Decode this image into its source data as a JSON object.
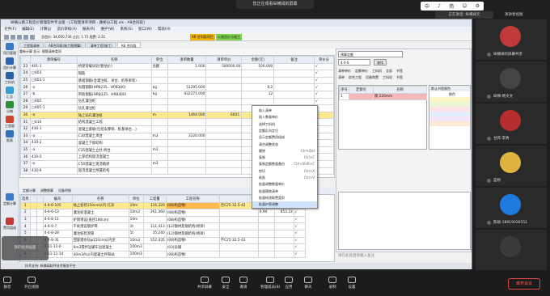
{
  "meeting": {
    "banner": "您正在观看纵横阔的屏幕",
    "speaking": "正在讲话: 纵横阔元",
    "gallery_view": "演讲者视图",
    "ime_items": [
      "中",
      "♪",
      "简",
      "☺",
      "⚙"
    ],
    "self_view": "我的视频画面",
    "participants": [
      {
        "name": "纵横阔的屏幕共享",
        "color": "#c13a3a"
      },
      {
        "name": "纵横-晓文文",
        "color": "#444"
      },
      {
        "name": "甘宾-李秀",
        "color": "#b52d2d"
      },
      {
        "name": "蓝桥",
        "color": "#e0b341"
      },
      {
        "name": "陈硕-18919036551",
        "color": "#1f7ae0"
      },
      {
        "name": "",
        "color": "#3a3a3a"
      }
    ],
    "bottom_bar": [
      {
        "label": "静音",
        "icon": "mic-icon"
      },
      {
        "label": "开启视频",
        "icon": "video-icon"
      },
      {
        "label": "共享屏幕",
        "icon": "share-screen-icon"
      },
      {
        "label": "安全",
        "icon": "shield-icon"
      },
      {
        "label": "邀请",
        "icon": "invite-icon"
      },
      {
        "label": "管理成员(8)",
        "icon": "members-icon"
      },
      {
        "label": "应用",
        "icon": "apps-icon"
      },
      {
        "label": "聊天",
        "icon": "chat-icon"
      },
      {
        "label": "录制",
        "icon": "record-icon"
      },
      {
        "label": "设置",
        "icon": "gear-icon"
      }
    ],
    "leave_label": "离开会议"
  },
  "app": {
    "title": "纵横公路工程造价管理软件专业版 - [工程量清单项目 - 路桥分工程.xls - AB合同段]",
    "menu": [
      "文件(F)",
      "编辑(E)",
      "计算(J)",
      "造价审核(A)",
      "报表(R)",
      "维护(W)",
      "系统(S)",
      "窗口(W)",
      "帮助(H)"
    ],
    "stats": "总造价: 34,650,736   占比: 1.71   规费: 2.31",
    "hl_btn_1": "AB 合同段项目",
    "hl_btn_2": "公路造价与施工",
    "tabs": [
      "工程量清单",
      "AB合同段(施工图预算)",
      "清单工程(施工)",
      "AB 合同段"
    ],
    "sub_toolbar": "重新计算   显示: 钢筋清单类项",
    "sidebar": [
      "项目管理",
      "造价计算",
      "工料机",
      "汇总",
      "分摊",
      "工程量",
      "报表",
      "定额计算",
      "费用组成"
    ],
    "upper_header": [
      "",
      "清单编号",
      "名称",
      "单位",
      "清单数量",
      "清单单价",
      "金额(元)",
      "备注",
      "单价分"
    ],
    "upper_rows": [
      [
        "23",
        "  401-1",
        "桥梁荷载试验(暂估价)",
        "总额",
        "1.000",
        "500000.00",
        "500,000",
        "",
        "√"
      ],
      [
        "24",
        "□403",
        "钢筋",
        "",
        "",
        "",
        "",
        "",
        "√"
      ],
      [
        "25",
        "  □403-1",
        "基础钢筋(含灌注桩、承台、桩系梁等)",
        "",
        "",
        "",
        "",
        "",
        "√"
      ],
      [
        "26",
        "    -a",
        "光圆钢筋(HPB235、HPB300)",
        "kg",
        "51295.000",
        "",
        "8,2",
        "",
        "√"
      ],
      [
        "27",
        "    -b",
        "带肋钢筋(HRB335、HRB400)",
        "kg",
        "932271.000",
        "",
        "12",
        "",
        "√"
      ],
      [
        "28",
        "  □405",
        "钻孔灌注桩",
        "",
        "",
        "",
        "",
        "",
        "√"
      ],
      [
        "29",
        "    □405-1",
        "钻孔灌注桩",
        "",
        "",
        "",
        "",
        "",
        "√"
      ],
      [
        "30",
        "    -a",
        "陆上钻孔灌注桩",
        "m",
        "1464.000",
        "6601.",
        "",
        "",
        "√"
      ],
      [
        "31",
        "□410",
        "结构混凝土工程",
        "",
        "",
        "",
        "",
        "",
        "√"
      ],
      [
        "32",
        "  410-1",
        "混凝土基础(包括支撑梁、桩基承台…)",
        "",
        "",
        "",
        "",
        "",
        "√"
      ],
      [
        "33",
        "    -a",
        "C30混凝土承台",
        "m3",
        "3220.000",
        "",
        "",
        "",
        "√"
      ],
      [
        "34",
        "  410-2",
        "混凝土下部结构",
        "",
        "",
        "",
        "",
        "",
        "√"
      ],
      [
        "35",
        "    -a",
        "C35混凝土立柱 桥台",
        "m3",
        "",
        "",
        "",
        "",
        "√"
      ],
      [
        "36",
        "  410-5",
        "上部结构现浇混凝土",
        "",
        "",
        "",
        "",
        "",
        "√"
      ],
      [
        "37",
        "    -a",
        "C50混凝土现浇箱梁",
        "m3",
        "",
        "",
        "",
        "",
        "√"
      ],
      [
        "38",
        "  410-6",
        "现浇混凝土附属结构",
        "",
        "",
        "",
        "",
        "",
        "√"
      ]
    ],
    "lower_tabs": [
      "定额计算",
      "调整换算",
      "设备明细"
    ],
    "lower_header": [
      "选择",
      "",
      "",
      "编号",
      "名称",
      "单位",
      "工程量",
      "工程名称",
      "",
      "",
      "单价",
      "合价"
    ],
    "lower_rows": [
      [
        "1",
        "",
        "",
        "4-4-6-105",
        "陆上桩径150cm以内 孔深",
        "10m",
        "116.320",
        "(08)构造物Ⅰ",
        "否C25-32.5-42",
        "6,94",
        "653.33",
        "√"
      ],
      [
        "2",
        "",
        "",
        "4-4-6-13",
        "灌注桩混凝土",
        "10m3",
        "261.360",
        "(08)构造物Ⅰ",
        "",
        "6,94",
        "653.33",
        "√"
      ],
      [
        "3",
        "",
        "",
        "4-4-8-11",
        "护筒埋设(直径180cm)",
        "10m",
        "",
        "(08)构造物Ⅰ",
        "",
        "",
        "",
        "√"
      ],
      [
        "4",
        "",
        "",
        "4-4-9-7",
        "干处埋设钢护筒",
        "1t",
        "111.413",
        "(12)钢材及钢结构(桥梁)",
        "",
        "",
        "",
        "√"
      ],
      [
        "5",
        "",
        "",
        "4-4-8-28",
        "灌注桩检测管",
        "1t",
        "35.240",
        "(12)钢材及钢结构(桥梁)",
        "",
        "",
        "",
        "√"
      ],
      [
        "6",
        "",
        "",
        "4-4-8-31",
        "回旋潜水钻φ150cm以内泥",
        "10m3",
        "552.435",
        "(08)构造物Ⅰ",
        "不C25-32.5-42",
        "",
        "",
        "√"
      ],
      [
        "7",
        "",
        "",
        "4-11-11-6",
        "6m3搅拌运输车运混凝土",
        "100m3",
        "",
        "(03)运输",
        "",
        "",
        "",
        "√"
      ],
      [
        "8",
        "",
        "",
        "4-11-11-14",
        "40m3/h以内混凝土拌和站",
        "100m3",
        "",
        "(08)构造物Ⅰ",
        "",
        "",
        "",
        "√"
      ]
    ],
    "context_menu": [
      {
        "label": "插入清单",
        "shortcut": ""
      },
      {
        "label": "插入数量单价",
        "shortcut": ""
      },
      {
        "label": "选择工料机",
        "shortcut": ""
      },
      {
        "label": "定额反向定位",
        "shortcut": ""
      },
      {
        "label": "显示定额费用组成",
        "shortcut": ""
      },
      {
        "label": "清空调整状态",
        "shortcut": ""
      },
      {
        "label": "删除",
        "shortcut": "Ctrl+Del"
      },
      {
        "label": "复制",
        "shortcut": "Ctrl+C"
      },
      {
        "label": "复制定额数量备份",
        "shortcut": "Ctrl+Shift+C"
      },
      {
        "label": "剪切",
        "shortcut": "Ctrl+X"
      },
      {
        "label": "粘贴",
        "shortcut": "Ctrl+V"
      },
      {
        "label": "批量调整数量单价",
        "shortcut": ""
      },
      {
        "label": "批量替换清单",
        "shortcut": ""
      },
      {
        "label": "批量修改取费类别",
        "shortcut": ""
      },
      {
        "label": "批量护筒调整",
        "shortcut": ""
      }
    ],
    "right_panel": {
      "dropdown": "预算定额",
      "search_input": "4-4-6",
      "search_btn": "查找",
      "radio_1": [
        "清单单价",
        "定额单价",
        "工料机",
        "全部",
        "书签"
      ],
      "radio_2": [
        "清单",
        "综合工程",
        "设备购置",
        "工料机",
        "书签"
      ],
      "small_header": [
        "序号",
        "定额号",
        "名称"
      ],
      "small_row": [
        "1",
        "",
        "厚 220mm"
      ],
      "color_header": "默认书签颜色",
      "color_label": "颜色",
      "notes_placeholder": "请在此处直接输入备注"
    },
    "status": "技术支持: 纵横阔软件技术服务平台"
  }
}
